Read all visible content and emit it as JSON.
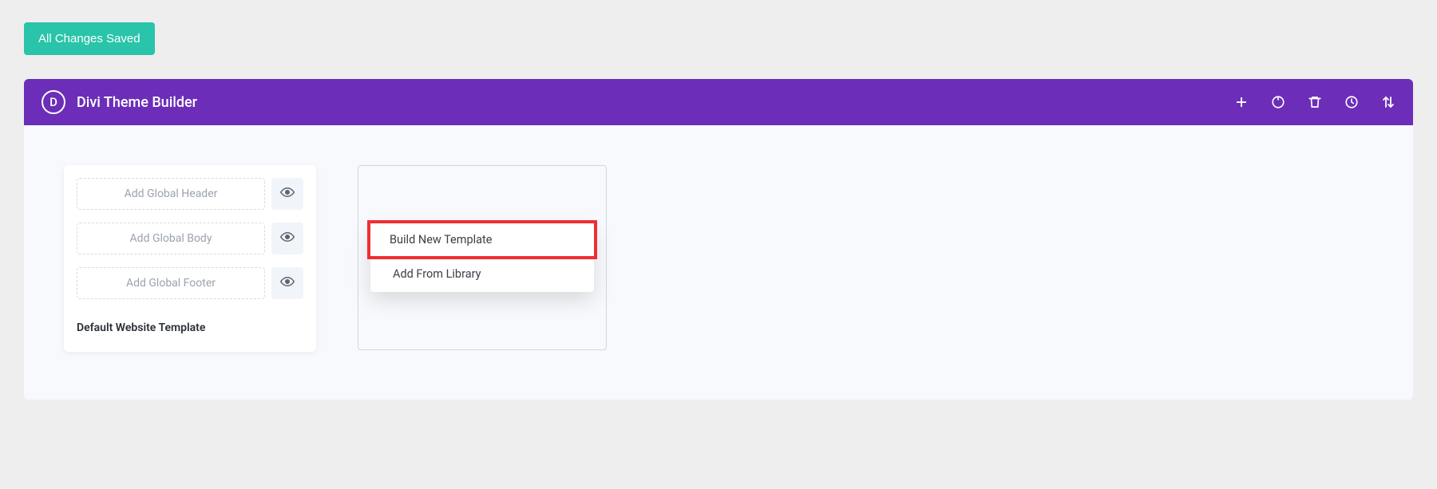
{
  "save_button": "All Changes Saved",
  "header": {
    "logo_letter": "D",
    "title": "Divi Theme Builder"
  },
  "template": {
    "slots": [
      {
        "label": "Add Global Header"
      },
      {
        "label": "Add Global Body"
      },
      {
        "label": "Add Global Footer"
      }
    ],
    "name": "Default Website Template"
  },
  "popup": {
    "build_new": "Build New Template",
    "add_from_library": "Add From Library"
  }
}
